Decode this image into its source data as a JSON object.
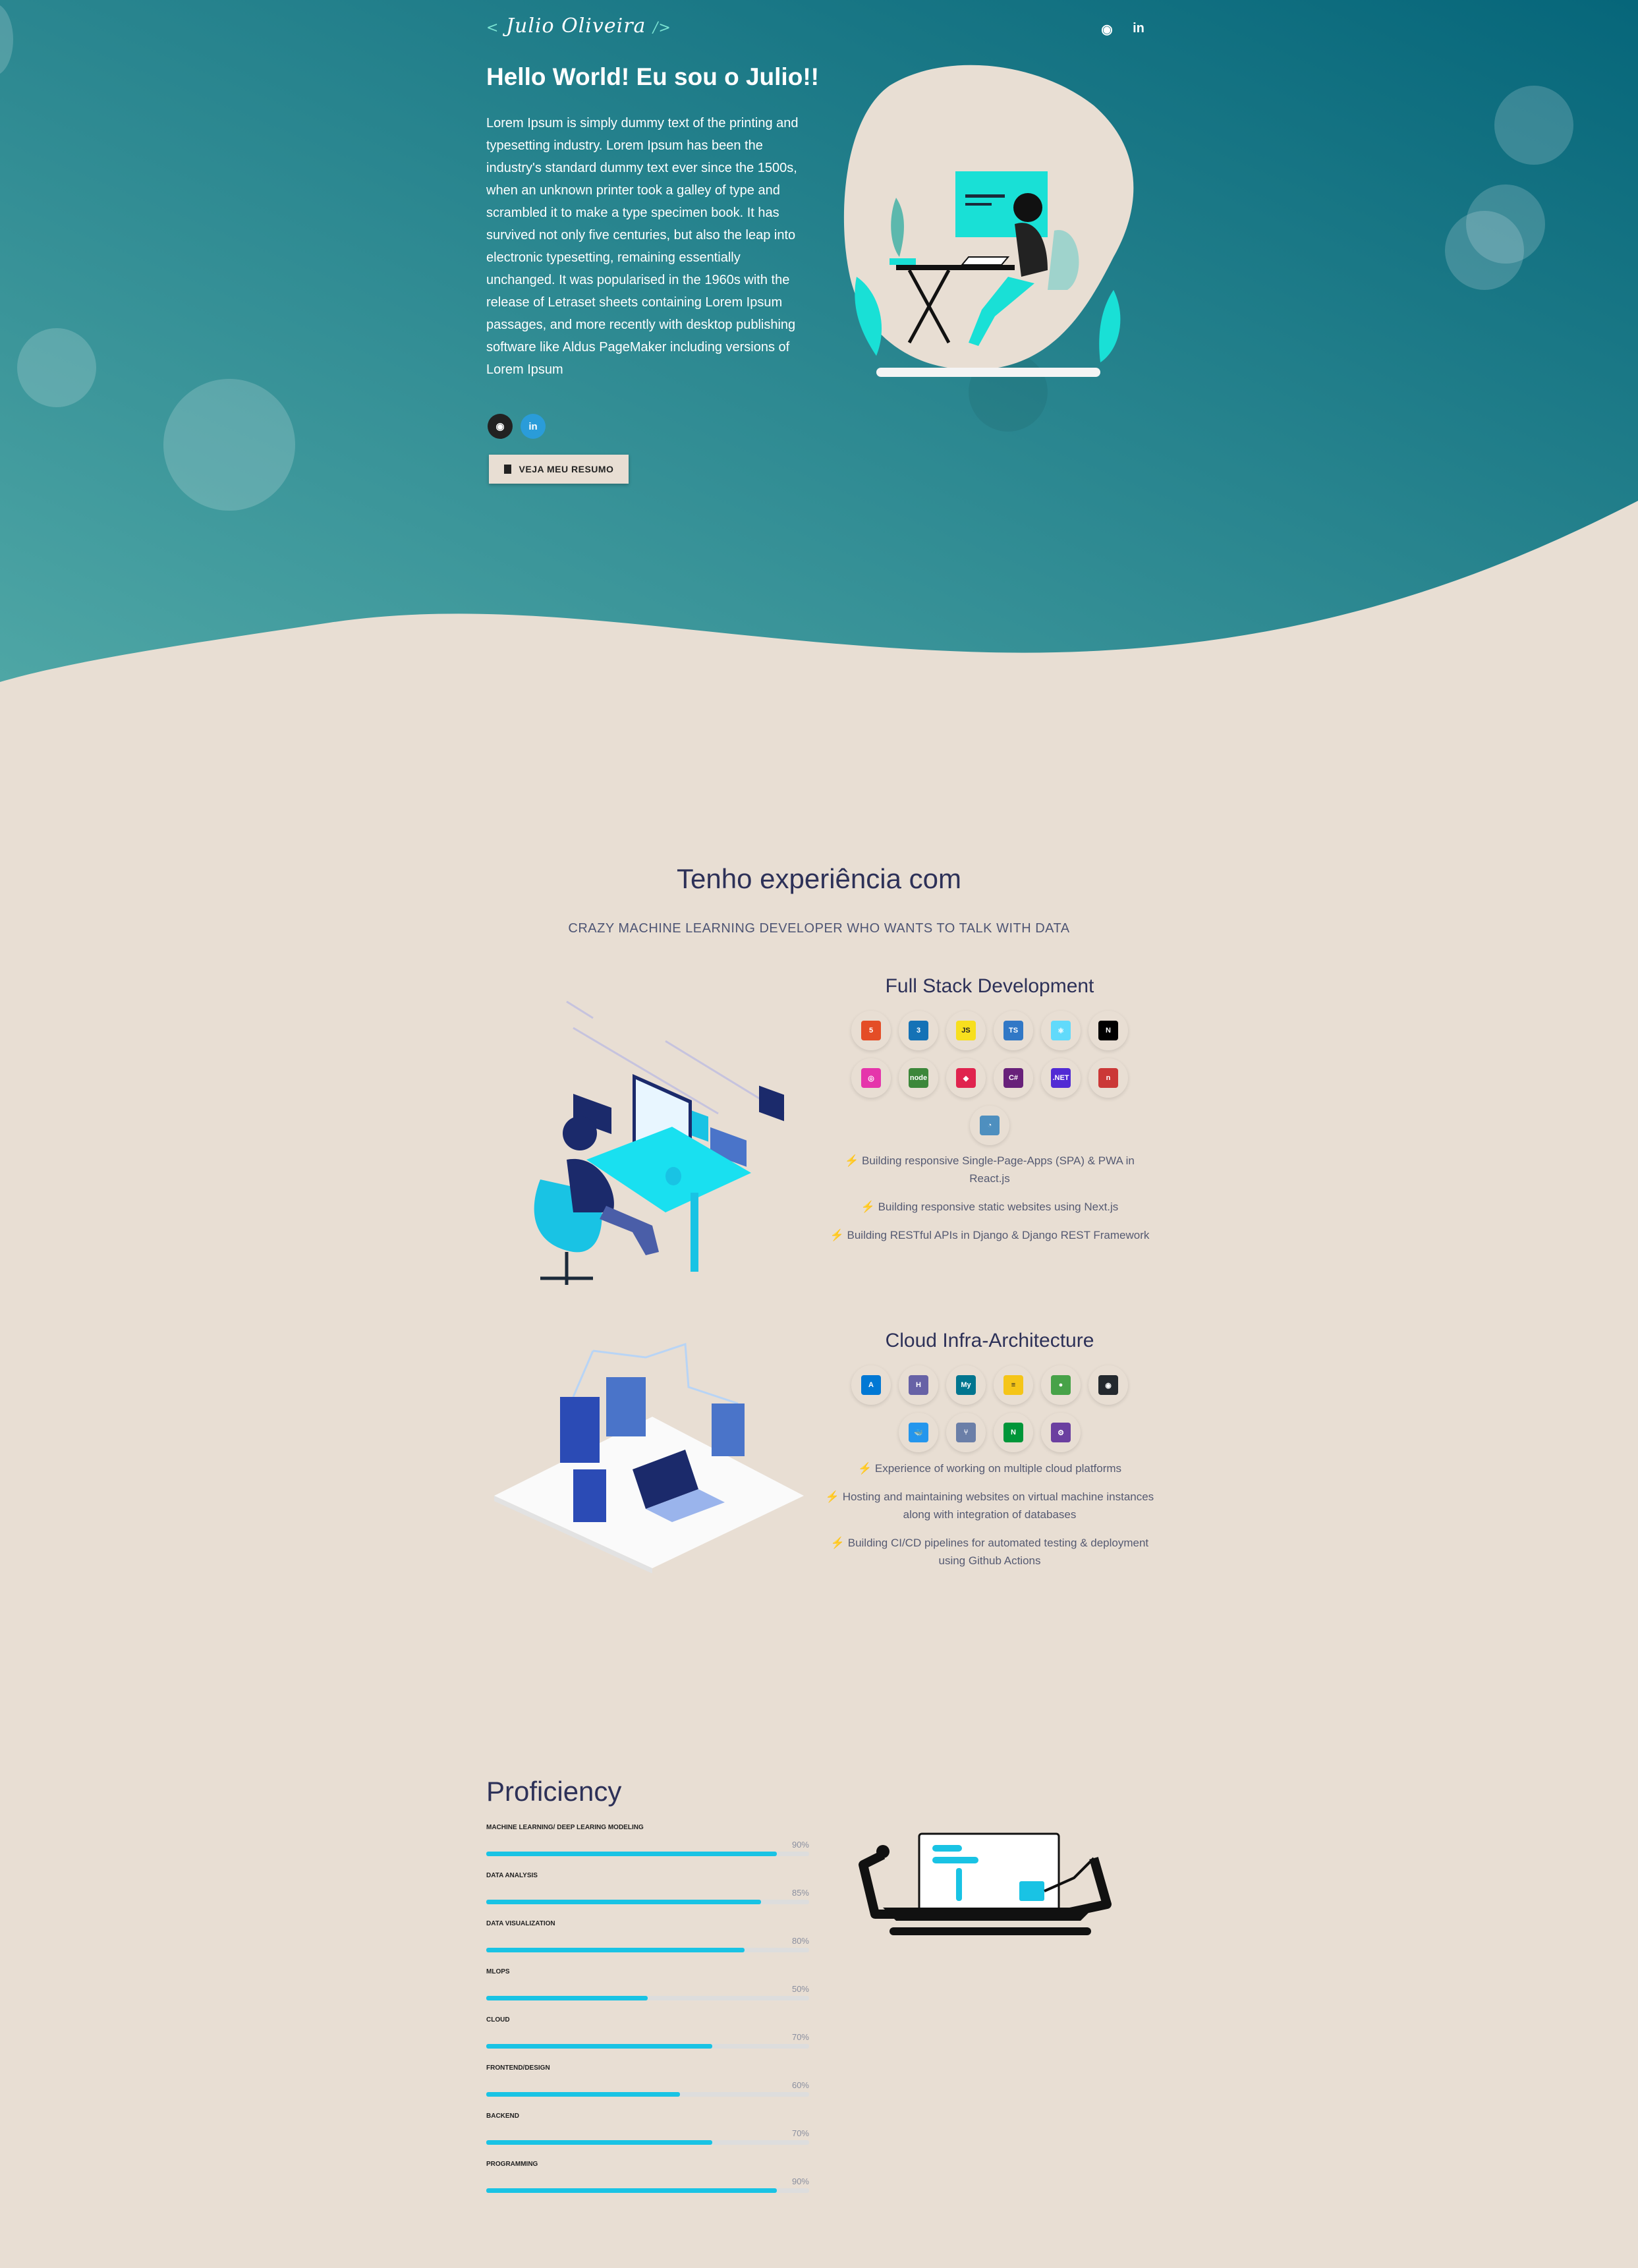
{
  "header": {
    "logo_text": "Julio Oliveira",
    "logo_open": "<",
    "logo_close": "/>",
    "nav_icons": [
      "github-icon",
      "linkedin-icon"
    ],
    "github_glyph": "◉",
    "linkedin_glyph": "in"
  },
  "hero": {
    "greeting": "Hello World! Eu sou o Julio!!",
    "intro": "Lorem Ipsum is simply dummy text of the printing and typesetting industry. Lorem Ipsum has been the industry's standard dummy text ever since the 1500s, when an unknown printer took a galley of type and scrambled it to make a type specimen book. It has survived not only five centuries, but also the leap into electronic typesetting, remaining essentially unchanged. It was popularised in the 1960s with the release of Letraset sheets containing Lorem Ipsum passages, and more recently with desktop publishing software like Aldus PageMaker including versions of Lorem Ipsum",
    "resume_button": "VEJA MEU RESUMO",
    "colors": {
      "gradient_start": "#4aa3a3",
      "gradient_end": "#08697a",
      "page_bg": "#e8ded3",
      "accent": "#19c3e4"
    }
  },
  "experience": {
    "title": "Tenho experiência com",
    "subtitle": "CRAZY MACHINE LEARNING DEVELOPER WHO WANTS TO TALK WITH DATA",
    "fullstack": {
      "title": "Full Stack Development",
      "icons": [
        {
          "name": "html5-icon",
          "label": "5",
          "color": "#e44d26"
        },
        {
          "name": "css3-icon",
          "label": "3",
          "color": "#1572b6"
        },
        {
          "name": "javascript-icon",
          "label": "JS",
          "color": "#f7df1e"
        },
        {
          "name": "typescript-icon",
          "label": "TS",
          "color": "#3178c6"
        },
        {
          "name": "react-icon",
          "label": "⚛",
          "color": "#61dafb"
        },
        {
          "name": "nextjs-icon",
          "label": "N",
          "color": "#000000"
        },
        {
          "name": "graphql-icon",
          "label": "◎",
          "color": "#e535ab"
        },
        {
          "name": "nodejs-icon",
          "label": "node",
          "color": "#3c873a"
        },
        {
          "name": "nestjs-icon",
          "label": "◆",
          "color": "#e0234e"
        },
        {
          "name": "csharp-icon",
          "label": "C#",
          "color": "#68217a"
        },
        {
          "name": "dotnet-icon",
          "label": ".NET",
          "color": "#512bd4"
        },
        {
          "name": "npm-icon",
          "label": "n",
          "color": "#cb3837"
        },
        {
          "name": "mariadb-icon",
          "label": "◔",
          "color": "#4e8fbf"
        }
      ],
      "bullets": [
        "Building responsive Single-Page-Apps (SPA) & PWA in React.js",
        "Building responsive static websites using Next.js",
        "Building RESTful APIs in Django & Django REST Framework"
      ]
    },
    "cloud": {
      "title": "Cloud Infra-Architecture",
      "icons": [
        {
          "name": "azure-icon",
          "label": "A",
          "color": "#0078d4"
        },
        {
          "name": "heroku-icon",
          "label": "H",
          "color": "#6762a6"
        },
        {
          "name": "mysql-icon",
          "label": "My",
          "color": "#00758f"
        },
        {
          "name": "database-icon",
          "label": "≡",
          "color": "#f5c518"
        },
        {
          "name": "mongodb-icon",
          "label": "●",
          "color": "#47a248"
        },
        {
          "name": "github-icon",
          "label": "◉",
          "color": "#24292e"
        },
        {
          "name": "docker-icon",
          "label": "🐳",
          "color": "#2496ed"
        },
        {
          "name": "git-icon",
          "label": "⑂",
          "color": "#6b7fa8"
        },
        {
          "name": "nginx-icon",
          "label": "N",
          "color": "#009639"
        },
        {
          "name": "postman-icon",
          "label": "⚙",
          "color": "#6b3fa0"
        }
      ],
      "bullets": [
        "Experience of working on multiple cloud platforms",
        "Hosting and maintaining websites on virtual machine instances along with integration of databases",
        "Building CI/CD pipelines for automated testing & deployment using Github Actions"
      ]
    }
  },
  "proficiency": {
    "title": "Proficiency",
    "bars": [
      {
        "label": "MACHINE LEARNING/ DEEP LEARING MODELING",
        "percent": 90,
        "text": "90%"
      },
      {
        "label": "DATA ANALYSIS",
        "percent": 85,
        "text": "85%"
      },
      {
        "label": "DATA VISUALIZATION",
        "percent": 80,
        "text": "80%"
      },
      {
        "label": "MLOPS",
        "percent": 50,
        "text": "50%"
      },
      {
        "label": "CLOUD",
        "percent": 70,
        "text": "70%"
      },
      {
        "label": "FRONTEND/DESIGN",
        "percent": 60,
        "text": "60%"
      },
      {
        "label": "BACKEND",
        "percent": 70,
        "text": "70%"
      },
      {
        "label": "PROGRAMMING",
        "percent": 90,
        "text": "90%"
      }
    ]
  }
}
